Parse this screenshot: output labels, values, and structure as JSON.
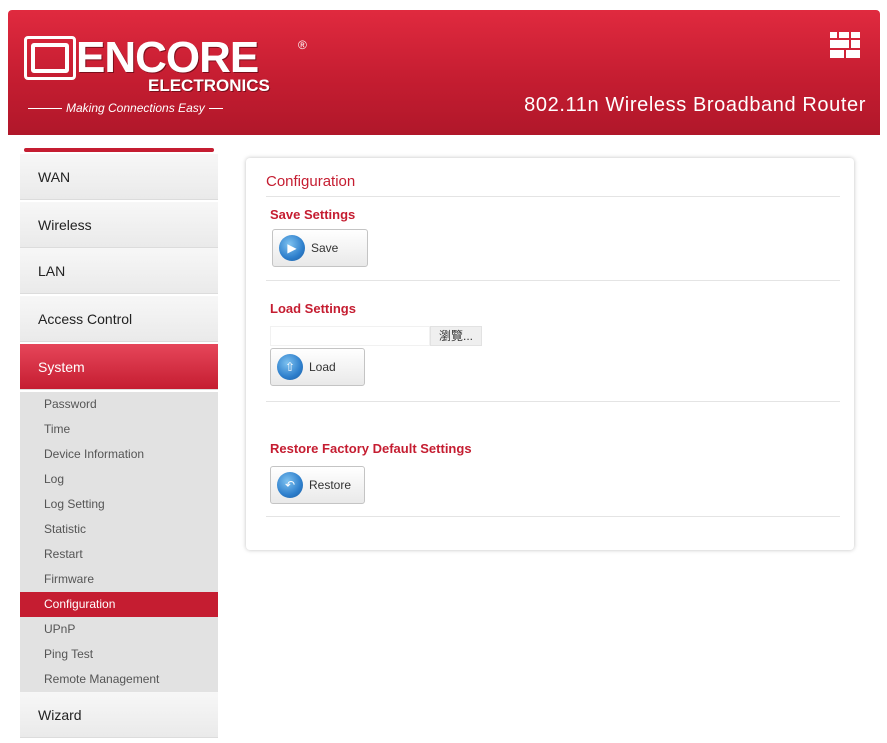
{
  "header": {
    "brand": "ENCORE",
    "registered": "®",
    "brand_sub": "ELECTRONICS",
    "tagline": "Making Connections Easy",
    "product": "802.11n Wireless Broadband Router"
  },
  "sidebar": {
    "items_top": [
      {
        "label": "WAN"
      },
      {
        "label": "Wireless"
      },
      {
        "label": "LAN"
      },
      {
        "label": "Access Control"
      },
      {
        "label": "System"
      }
    ],
    "sub_items": [
      {
        "label": "Password"
      },
      {
        "label": "Time"
      },
      {
        "label": "Device Information"
      },
      {
        "label": "Log"
      },
      {
        "label": "Log Setting"
      },
      {
        "label": "Statistic"
      },
      {
        "label": "Restart"
      },
      {
        "label": "Firmware"
      },
      {
        "label": "Configuration"
      },
      {
        "label": "UPnP"
      },
      {
        "label": "Ping Test"
      },
      {
        "label": "Remote Management"
      }
    ],
    "items_bottom": [
      {
        "label": "Wizard"
      }
    ],
    "active_main": "System",
    "active_sub": "Configuration"
  },
  "content": {
    "title": "Configuration",
    "save": {
      "title": "Save Settings",
      "button": "Save"
    },
    "load": {
      "title": "Load Settings",
      "file_value": "",
      "browse_button": "瀏覽...",
      "button": "Load"
    },
    "restore": {
      "title": "Restore Factory Default Settings",
      "button": "Restore"
    }
  },
  "colors": {
    "accent": "#c51d31",
    "header_red": "#e02a3f",
    "section_text": "#c51d31"
  },
  "icons": {
    "save": "play-arrow-icon",
    "load": "upload-arrow-icon",
    "restore": "restore-arrow-icon",
    "header": "grid-icon"
  }
}
